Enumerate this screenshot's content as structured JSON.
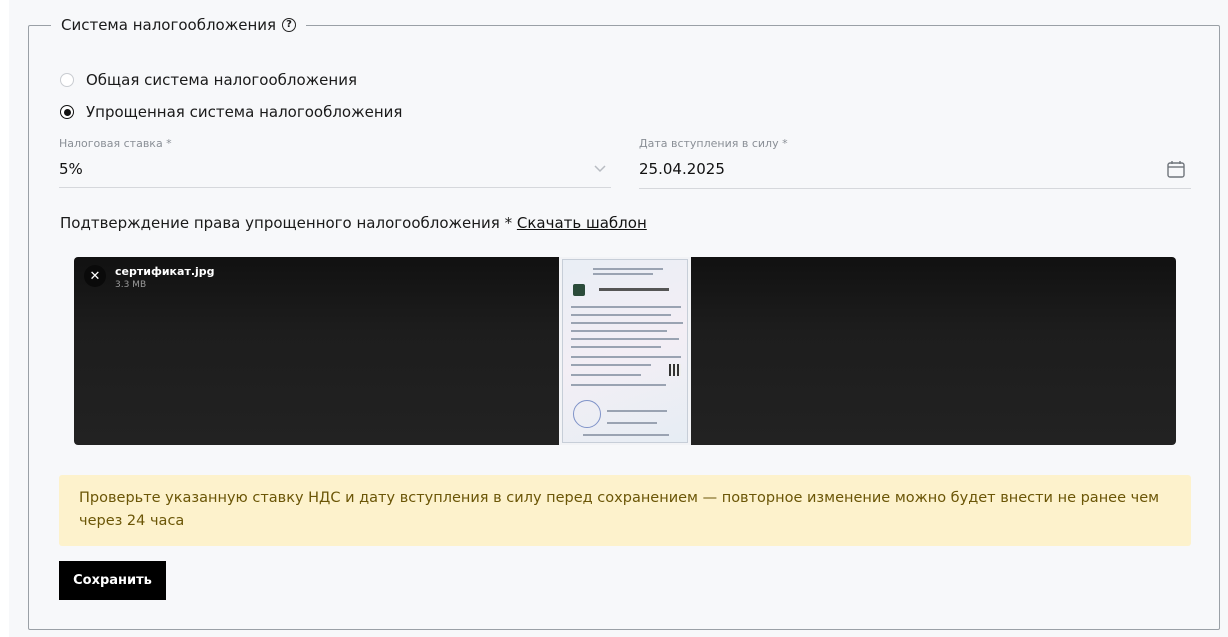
{
  "section": {
    "title": "Система налогообложения",
    "help_icon": "question-circle-icon"
  },
  "tax_system": {
    "options": [
      {
        "label": "Общая система налогообложения",
        "selected": false
      },
      {
        "label": "Упрощенная система налогообложения",
        "selected": true
      }
    ]
  },
  "tax_rate": {
    "label": "Налоговая ставка *",
    "value": "5%",
    "icon": "chevron-down-icon"
  },
  "effective_date": {
    "label": "Дата вступления в силу *",
    "value": "25.04.2025",
    "icon": "calendar-icon"
  },
  "confirmation": {
    "text": "Подтверждение права упрощенного налогообложения *",
    "download_link": "Скачать шаблон"
  },
  "attachment": {
    "file_name": "сертификат.jpg",
    "file_size": "3.3 MB",
    "close_icon": "close-icon"
  },
  "warning": {
    "text": "Проверьте указанную ставку НДС и дату вступления в силу перед сохранением — повторное изменение можно будет внести не ранее чем через 24 часа",
    "background": "#fdf2cc",
    "color": "#6b5607"
  },
  "actions": {
    "save_label": "Сохранить"
  }
}
